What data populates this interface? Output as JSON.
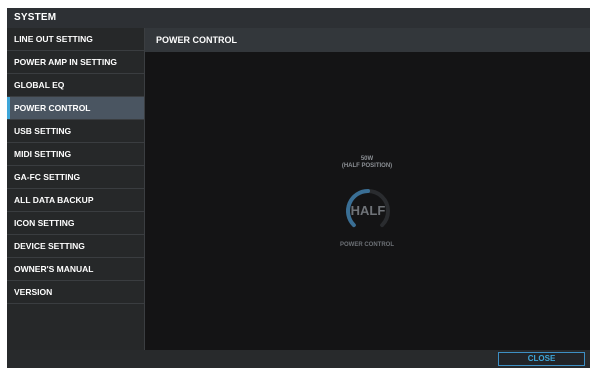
{
  "title": "SYSTEM",
  "sidebar": {
    "items": [
      {
        "label": "LINE OUT SETTING"
      },
      {
        "label": "POWER AMP IN SETTING"
      },
      {
        "label": "GLOBAL EQ"
      },
      {
        "label": "POWER CONTROL"
      },
      {
        "label": "USB SETTING"
      },
      {
        "label": "MIDI SETTING"
      },
      {
        "label": "GA-FC SETTING"
      },
      {
        "label": "ALL DATA BACKUP"
      },
      {
        "label": "ICON SETTING"
      },
      {
        "label": "DEVICE SETTING"
      },
      {
        "label": "OWNER'S MANUAL"
      },
      {
        "label": "VERSION"
      }
    ],
    "active_index": 3
  },
  "panel": {
    "header": "POWER CONTROL",
    "control": {
      "value_line1": "50W",
      "value_line2": "(HALF POSITION)",
      "knob_text": "HALF",
      "knob_level": 0.5,
      "label": "POWER CONTROL"
    }
  },
  "footer": {
    "close_label": "CLOSE"
  },
  "colors": {
    "accent": "#3ea6d9",
    "active_item_bg": "#4a5561",
    "knob_arc": "#3a6f95"
  }
}
